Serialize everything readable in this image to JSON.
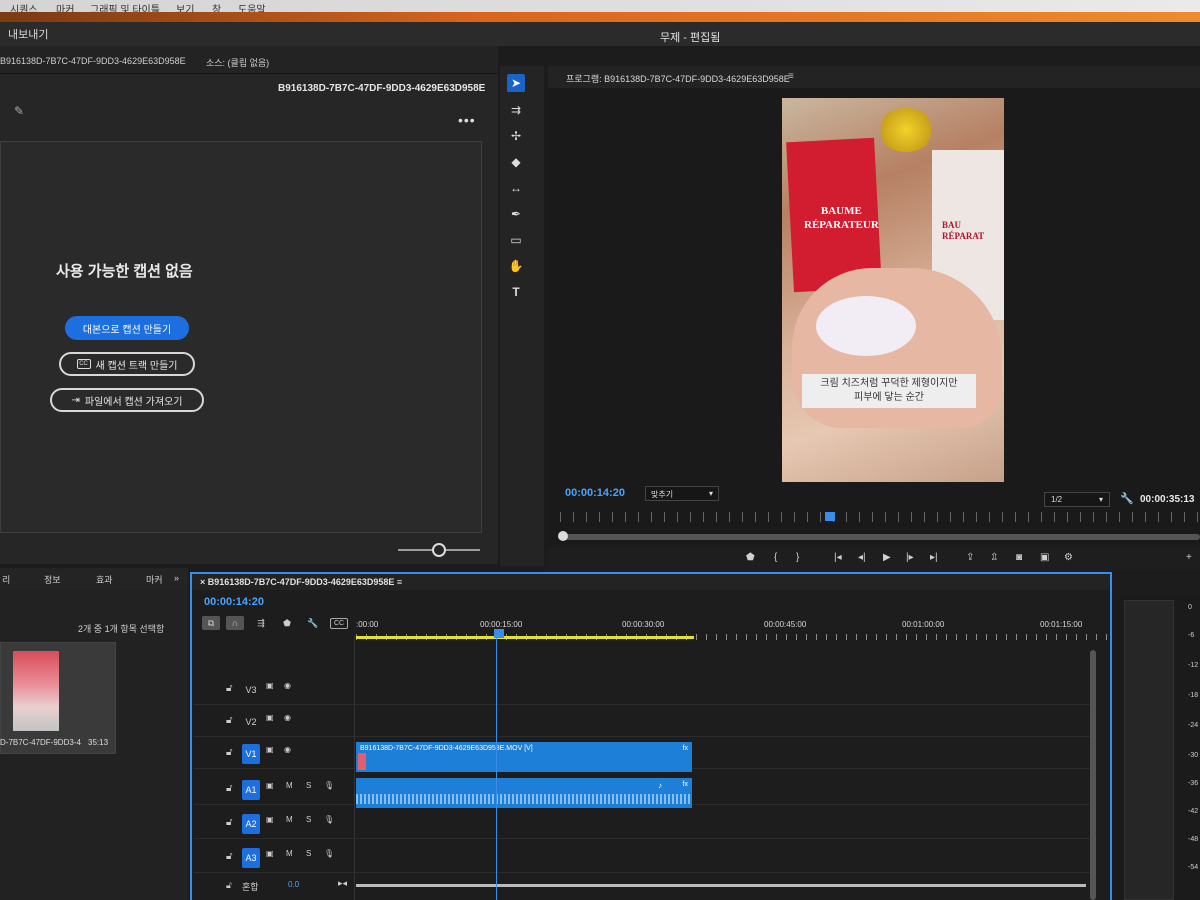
{
  "menu": [
    "시퀀스",
    "마커",
    "그래픽 및 타이틀",
    "보기",
    "창",
    "도움말"
  ],
  "titlebar": {
    "export": "내보내기",
    "workspace_title": "무제 - 편집됨"
  },
  "source_panel": {
    "left_id": "B916138D-7B7C-47DF-9DD3-4629E63D958E",
    "source_label": "소스: (클립 없음)",
    "right_id": "B916138D-7B7C-47DF-9DD3-4629E63D958E",
    "more": "•••",
    "no_captions": "사용 가능한 캡션 없음",
    "btn_transcript": "대본으로 캡션 만들기",
    "btn_new_track": "새 캡션 트랙 만들기",
    "btn_import": "파일에서 캡션 가져오기",
    "cc_badge": "CC"
  },
  "program_monitor": {
    "title": "프로그램: B916138D-7B7C-47DF-9DD3-4629E63D958E",
    "video_brand_left": "BAUME\nRÉPARATEUR",
    "video_brand_right": "BAU\nRÉPARAT",
    "subtitle_line1": "크림 치즈처럼 꾸덕한 제형이지만",
    "subtitle_line2": "피부에 닿는 순간",
    "timecode": "00:00:14:20",
    "fit_select": "맞추기",
    "resolution_select": "1/2",
    "duration": "00:00:35:13"
  },
  "project_panel": {
    "tabs": [
      "리",
      "정보",
      "효과",
      "마커"
    ],
    "selection_count": "2개 중 1개 항목 선택함",
    "item_name": "D-7B7C-47DF-9DD3-4",
    "item_duration": "35:13"
  },
  "timeline": {
    "sequence_title": "B916138D-7B7C-47DF-9DD3-4629E63D958E",
    "timecode": "00:00:14:20",
    "ruler_labels": [
      ":00:00",
      "00:00:15:00",
      "00:00:30:00",
      "00:00:45:00",
      "00:01:00:00",
      "00:01:15:00"
    ],
    "tracks": [
      "V3",
      "V2",
      "V1",
      "A1",
      "A2",
      "A3"
    ],
    "video_clip_label": "B916138D-7B7C-47DF-9DD3-4629E63D958E.MOV [V]",
    "fx": "fx",
    "mute": "M",
    "solo": "S",
    "mix_label": "혼합",
    "mix_value": "0.0"
  },
  "meters": {
    "ticks": [
      "0",
      "-6",
      "-12",
      "-18",
      "-24",
      "-30",
      "-36",
      "-42",
      "-48",
      "-54"
    ]
  },
  "colors": {
    "accent": "#1d6fe0",
    "timecode": "#4aa3ff",
    "clip": "#1d7fd8",
    "work_area": "#e4e22a"
  }
}
